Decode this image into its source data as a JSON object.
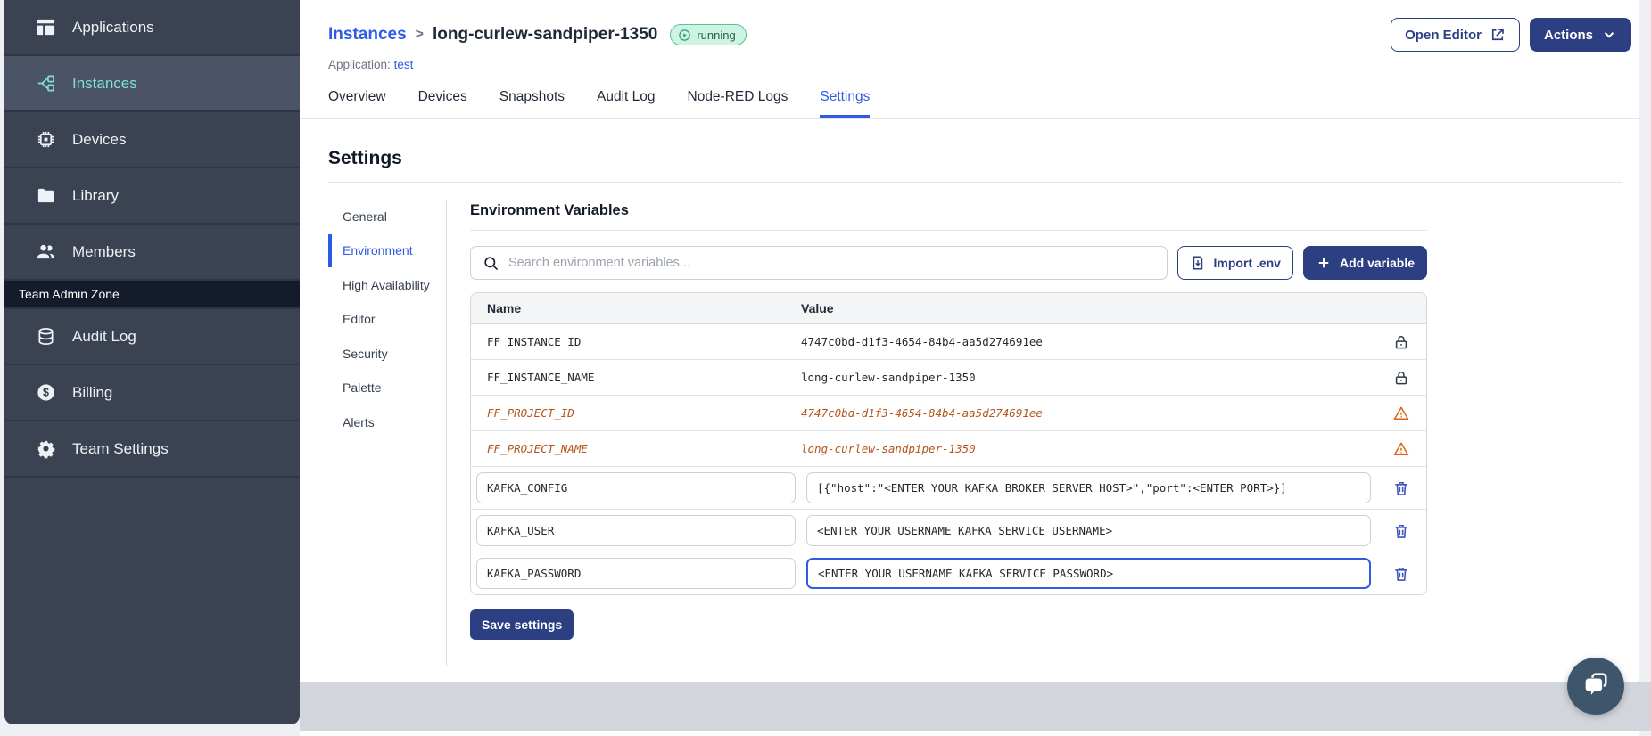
{
  "sidebar": {
    "items": [
      {
        "label": "Applications",
        "icon": "applications-icon",
        "active": false
      },
      {
        "label": "Instances",
        "icon": "instances-icon",
        "active": true
      },
      {
        "label": "Devices",
        "icon": "devices-icon",
        "active": false
      },
      {
        "label": "Library",
        "icon": "library-icon",
        "active": false
      },
      {
        "label": "Members",
        "icon": "members-icon",
        "active": false
      }
    ],
    "section_label": "Team Admin Zone",
    "admin_items": [
      {
        "label": "Audit Log",
        "icon": "audit-log-icon",
        "active": false
      },
      {
        "label": "Billing",
        "icon": "billing-icon",
        "active": false
      },
      {
        "label": "Team Settings",
        "icon": "team-settings-icon",
        "active": false
      }
    ]
  },
  "header": {
    "breadcrumb_parent": "Instances",
    "breadcrumb_separator": ">",
    "instance_name": "long-curlew-sandpiper-1350",
    "status_badge": "running",
    "application_label": "Application:",
    "application_name": "test",
    "open_editor_label": "Open Editor",
    "actions_label": "Actions"
  },
  "tabs": [
    {
      "label": "Overview",
      "active": false
    },
    {
      "label": "Devices",
      "active": false
    },
    {
      "label": "Snapshots",
      "active": false
    },
    {
      "label": "Audit Log",
      "active": false
    },
    {
      "label": "Node-RED Logs",
      "active": false
    },
    {
      "label": "Settings",
      "active": true
    }
  ],
  "settings": {
    "title": "Settings",
    "subnav": [
      {
        "label": "General",
        "active": false
      },
      {
        "label": "Environment",
        "active": true
      },
      {
        "label": "High Availability",
        "active": false
      },
      {
        "label": "Editor",
        "active": false
      },
      {
        "label": "Security",
        "active": false
      },
      {
        "label": "Palette",
        "active": false
      },
      {
        "label": "Alerts",
        "active": false
      }
    ],
    "section_title": "Environment Variables",
    "search_placeholder": "Search environment variables...",
    "import_button": "Import .env",
    "add_button": "Add variable",
    "table": {
      "columns": [
        "Name",
        "Value"
      ],
      "rows": [
        {
          "name": "FF_INSTANCE_ID",
          "value": "4747c0bd-d1f3-4654-84b4-aa5d274691ee",
          "state": "locked",
          "focused": false
        },
        {
          "name": "FF_INSTANCE_NAME",
          "value": "long-curlew-sandpiper-1350",
          "state": "locked",
          "focused": false
        },
        {
          "name": "FF_PROJECT_ID",
          "value": "4747c0bd-d1f3-4654-84b4-aa5d274691ee",
          "state": "deprecated",
          "focused": false
        },
        {
          "name": "FF_PROJECT_NAME",
          "value": "long-curlew-sandpiper-1350",
          "state": "deprecated",
          "focused": false
        },
        {
          "name": "KAFKA_CONFIG",
          "value": "[{\"host\":\"<ENTER YOUR KAFKA BROKER SERVER HOST>\",\"port\":<ENTER PORT>}]",
          "state": "editable",
          "focused": false
        },
        {
          "name": "KAFKA_USER",
          "value": "<ENTER YOUR USERNAME KAFKA SERVICE USERNAME>",
          "state": "editable",
          "focused": false
        },
        {
          "name": "KAFKA_PASSWORD",
          "value": "<ENTER YOUR USERNAME KAFKA SERVICE PASSWORD>",
          "state": "editable",
          "focused": true
        }
      ]
    },
    "save_button": "Save settings"
  },
  "colors": {
    "accent_blue": "#2e5ce6",
    "navy_button": "#2b3f82",
    "sidebar_bg": "#3b4252",
    "sidebar_active_bg": "#4b5466",
    "sidebar_active_text": "#7fe2d1",
    "admin_zone_bg": "#141b2b",
    "deprecated_orange": "#b4551b",
    "warning_orange": "#e0611a",
    "trash_blue": "#3a55bd",
    "badge_green_bg": "#cdf3e2",
    "badge_green_border": "#4ec79a",
    "footer_gray": "#d2d5dc",
    "chat_bubble_bg": "#3d566b"
  }
}
